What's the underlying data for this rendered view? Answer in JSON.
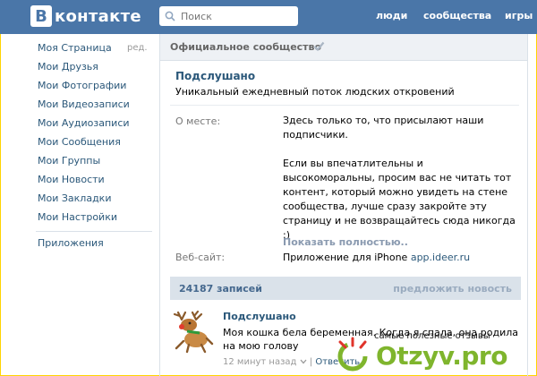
{
  "header": {
    "logo_badge": "В",
    "logo_text": "контакте",
    "search_placeholder": "Поиск",
    "nav": [
      "люди",
      "сообщества",
      "игры"
    ]
  },
  "sidebar": {
    "items": [
      {
        "label": "Моя Страница"
      },
      {
        "label": "Мои Друзья"
      },
      {
        "label": "Мои Фотографии"
      },
      {
        "label": "Мои Видеозаписи"
      },
      {
        "label": "Мои Аудиозаписи"
      },
      {
        "label": "Мои Сообщения"
      },
      {
        "label": "Мои Группы"
      },
      {
        "label": "Мои Новости"
      },
      {
        "label": "Мои Закладки"
      },
      {
        "label": "Мои Настройки"
      }
    ],
    "edit_label": "ред.",
    "apps_label": "Приложения"
  },
  "group": {
    "official_label": "Официальное сообщество",
    "name": "Подслушано",
    "status": "Уникальный ежедневный поток людских откровений",
    "about_label": "О месте:",
    "about_p1": "Здесь только то, что присылают наши подписчики.",
    "about_p2": "Если вы впечатлительны и высокоморальны, просим вас не читать тот контент, который можно увидеть на стене сообщества, лучше сразу закройте эту страницу и не возвращайтесь сюда никогда :)",
    "show_more": "Показать полностью..",
    "site_label": "Веб-сайт:",
    "site_prefix": "Приложение для iPhone",
    "site_link": "app.ideer.ru"
  },
  "wall": {
    "posts_count": "24187 записей",
    "suggest": "предложить новость"
  },
  "post": {
    "author": "Подслушано",
    "text": "Моя кошка бела беременная. Когда я спала, она родила на мою голову",
    "time": "12 минут назад",
    "separator": "|",
    "reply": "Ответить"
  },
  "watermark": {
    "tag": "самые полезные отзывы",
    "brand": "Otzyv.pro"
  },
  "colors": {
    "header": "#4a76a8",
    "link": "#2b587a",
    "watermark": "#7fb52d"
  }
}
